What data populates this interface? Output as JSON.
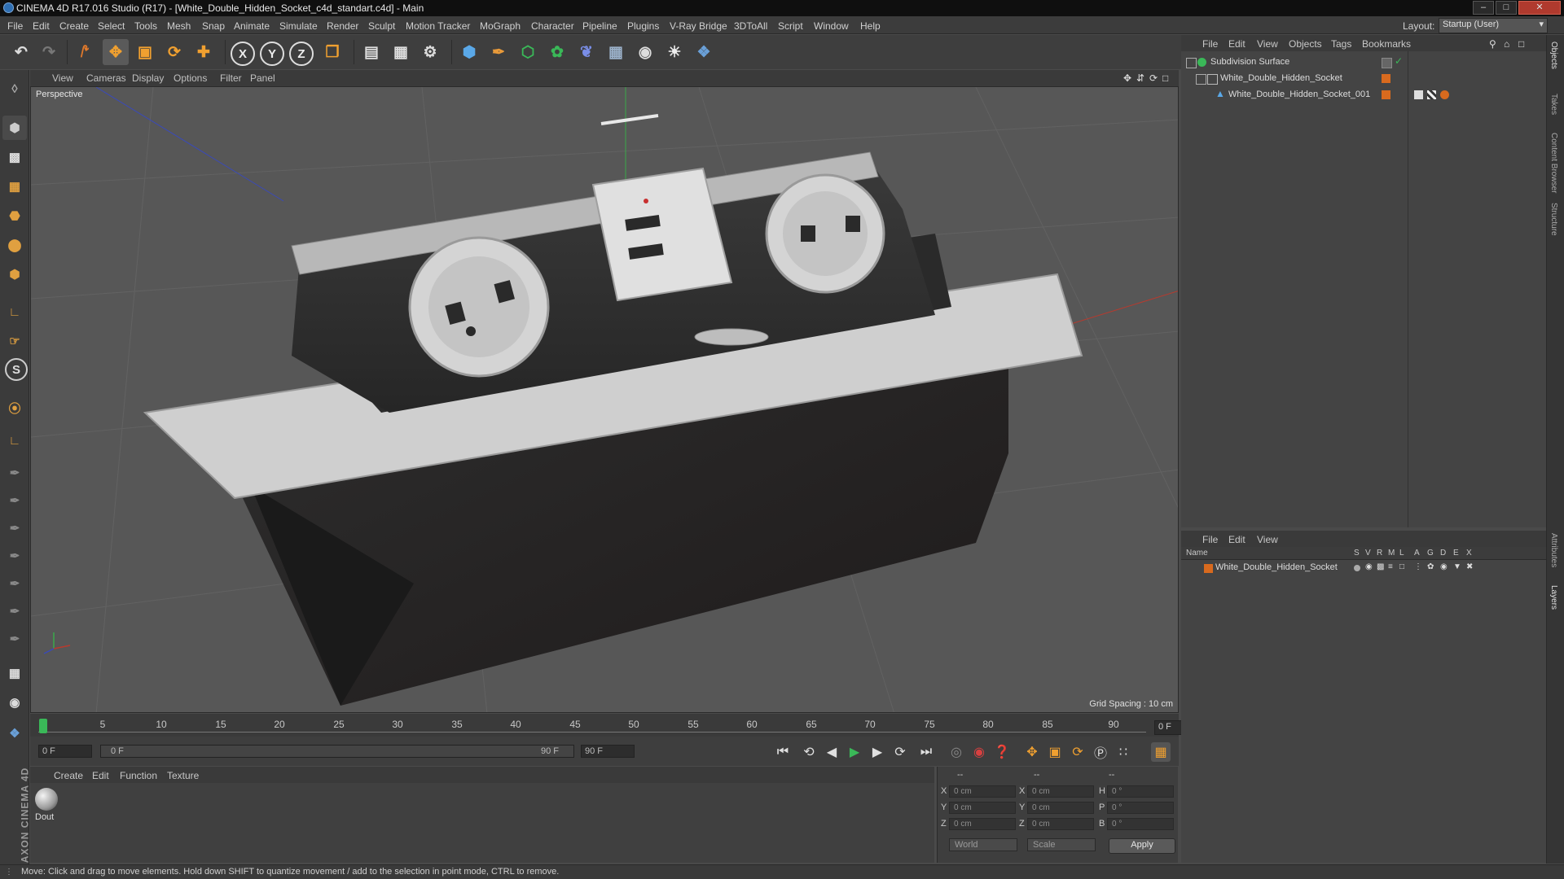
{
  "window": {
    "title": "CINEMA 4D R17.016 Studio (R17) - [White_Double_Hidden_Socket_c4d_standart.c4d] - Main",
    "buttons": [
      "minimize",
      "maximize",
      "close"
    ]
  },
  "menubar": {
    "items": [
      "File",
      "Edit",
      "Create",
      "Select",
      "Tools",
      "Mesh",
      "Snap",
      "Animate",
      "Simulate",
      "Render",
      "Sculpt",
      "Motion Tracker",
      "MoGraph",
      "Character",
      "Pipeline",
      "Plugins",
      "V-Ray Bridge",
      "3DToAll",
      "Script",
      "Window",
      "Help"
    ],
    "layout_label": "Layout:",
    "layout_value": "Startup (User)"
  },
  "toolbar": {
    "axis_x": "X",
    "axis_y": "Y",
    "axis_z": "Z"
  },
  "viewport": {
    "menu": [
      "View",
      "Cameras",
      "Display",
      "Options",
      "Filter",
      "Panel"
    ],
    "camera_label": "Perspective",
    "grid_spacing": "Grid Spacing : 10 cm"
  },
  "timeline": {
    "ticks": [
      "0",
      "5",
      "10",
      "15",
      "20",
      "25",
      "30",
      "35",
      "40",
      "45",
      "50",
      "55",
      "60",
      "65",
      "70",
      "75",
      "80",
      "85",
      "90"
    ],
    "current_frame": "0 F"
  },
  "transport": {
    "start_field": "0 F",
    "range_start": "0 F",
    "range_end": "90 F",
    "end_field": "90 F"
  },
  "material_manager": {
    "menu": [
      "Create",
      "Edit",
      "Function",
      "Texture"
    ],
    "material_name": "Dout"
  },
  "coordinates": {
    "headers": [
      "--",
      "--",
      "--"
    ],
    "pos_labels": [
      "X",
      "Y",
      "Z"
    ],
    "pos_values": [
      "0 cm",
      "0 cm",
      "0 cm"
    ],
    "size_labels": [
      "X",
      "Y",
      "Z"
    ],
    "size_values": [
      "0 cm",
      "0 cm",
      "0 cm"
    ],
    "rot_labels": [
      "H",
      "P",
      "B"
    ],
    "rot_values": [
      "0 °",
      "0 °",
      "0 °"
    ],
    "mode_select": "World",
    "scale_select": "Scale",
    "apply_label": "Apply"
  },
  "status_bar": {
    "text": "Move: Click and drag to move elements. Hold down SHIFT to quantize movement / add to the selection in point mode, CTRL to remove."
  },
  "object_manager": {
    "menu": [
      "File",
      "Edit",
      "View",
      "Objects",
      "Tags",
      "Bookmarks"
    ],
    "objects": [
      {
        "name": "Subdivision Surface"
      },
      {
        "name": "White_Double_Hidden_Socket"
      },
      {
        "name": "White_Double_Hidden_Socket_001"
      }
    ]
  },
  "layer_manager": {
    "menu": [
      "File",
      "Edit",
      "View"
    ],
    "columns": [
      "Name",
      "S",
      "V",
      "R",
      "M",
      "L",
      "A",
      "G",
      "D",
      "E",
      "X"
    ],
    "layers": [
      {
        "name": "White_Double_Hidden_Socket",
        "color": "#d86a1e"
      }
    ]
  },
  "right_tabs": [
    "Objects",
    "Takes",
    "Content Browser",
    "Structure",
    "Attributes",
    "Layers"
  ],
  "colors": {
    "accent_orange": "#d86a1e",
    "axis_red": "#c0392b",
    "axis_green": "#3aa84a",
    "axis_blue": "#3a5ad0",
    "viewport_bg": "#555555"
  }
}
